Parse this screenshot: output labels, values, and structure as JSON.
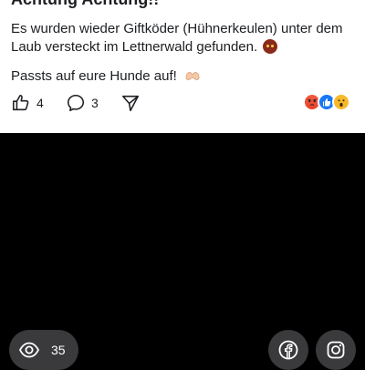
{
  "post": {
    "heading": "Achtung Achtung!!",
    "paragraph_1": "Es wurden wieder Giftköder (Hühnerkeulen) unter dem Laub versteckt im Lettnerwald gefunden.",
    "paragraph_2": "Passts auf eure Hunde auf!",
    "emoji_1": "angry-face-emoji",
    "emoji_2": "heart-hands-emoji"
  },
  "actions": {
    "like_count": "4",
    "comment_count": "3",
    "share_icon": "share-icon"
  },
  "reactions": [
    "angry",
    "like",
    "wow"
  ],
  "video_bar": {
    "views_count": "35",
    "view_icon": "eye-icon",
    "share_buttons": [
      "facebook",
      "instagram"
    ]
  },
  "colors": {
    "like_blue": "#1877f2",
    "angry_orange": "#e8412a",
    "wow_yellow": "#f7b928",
    "pill_grey": "#3a3a3c"
  }
}
